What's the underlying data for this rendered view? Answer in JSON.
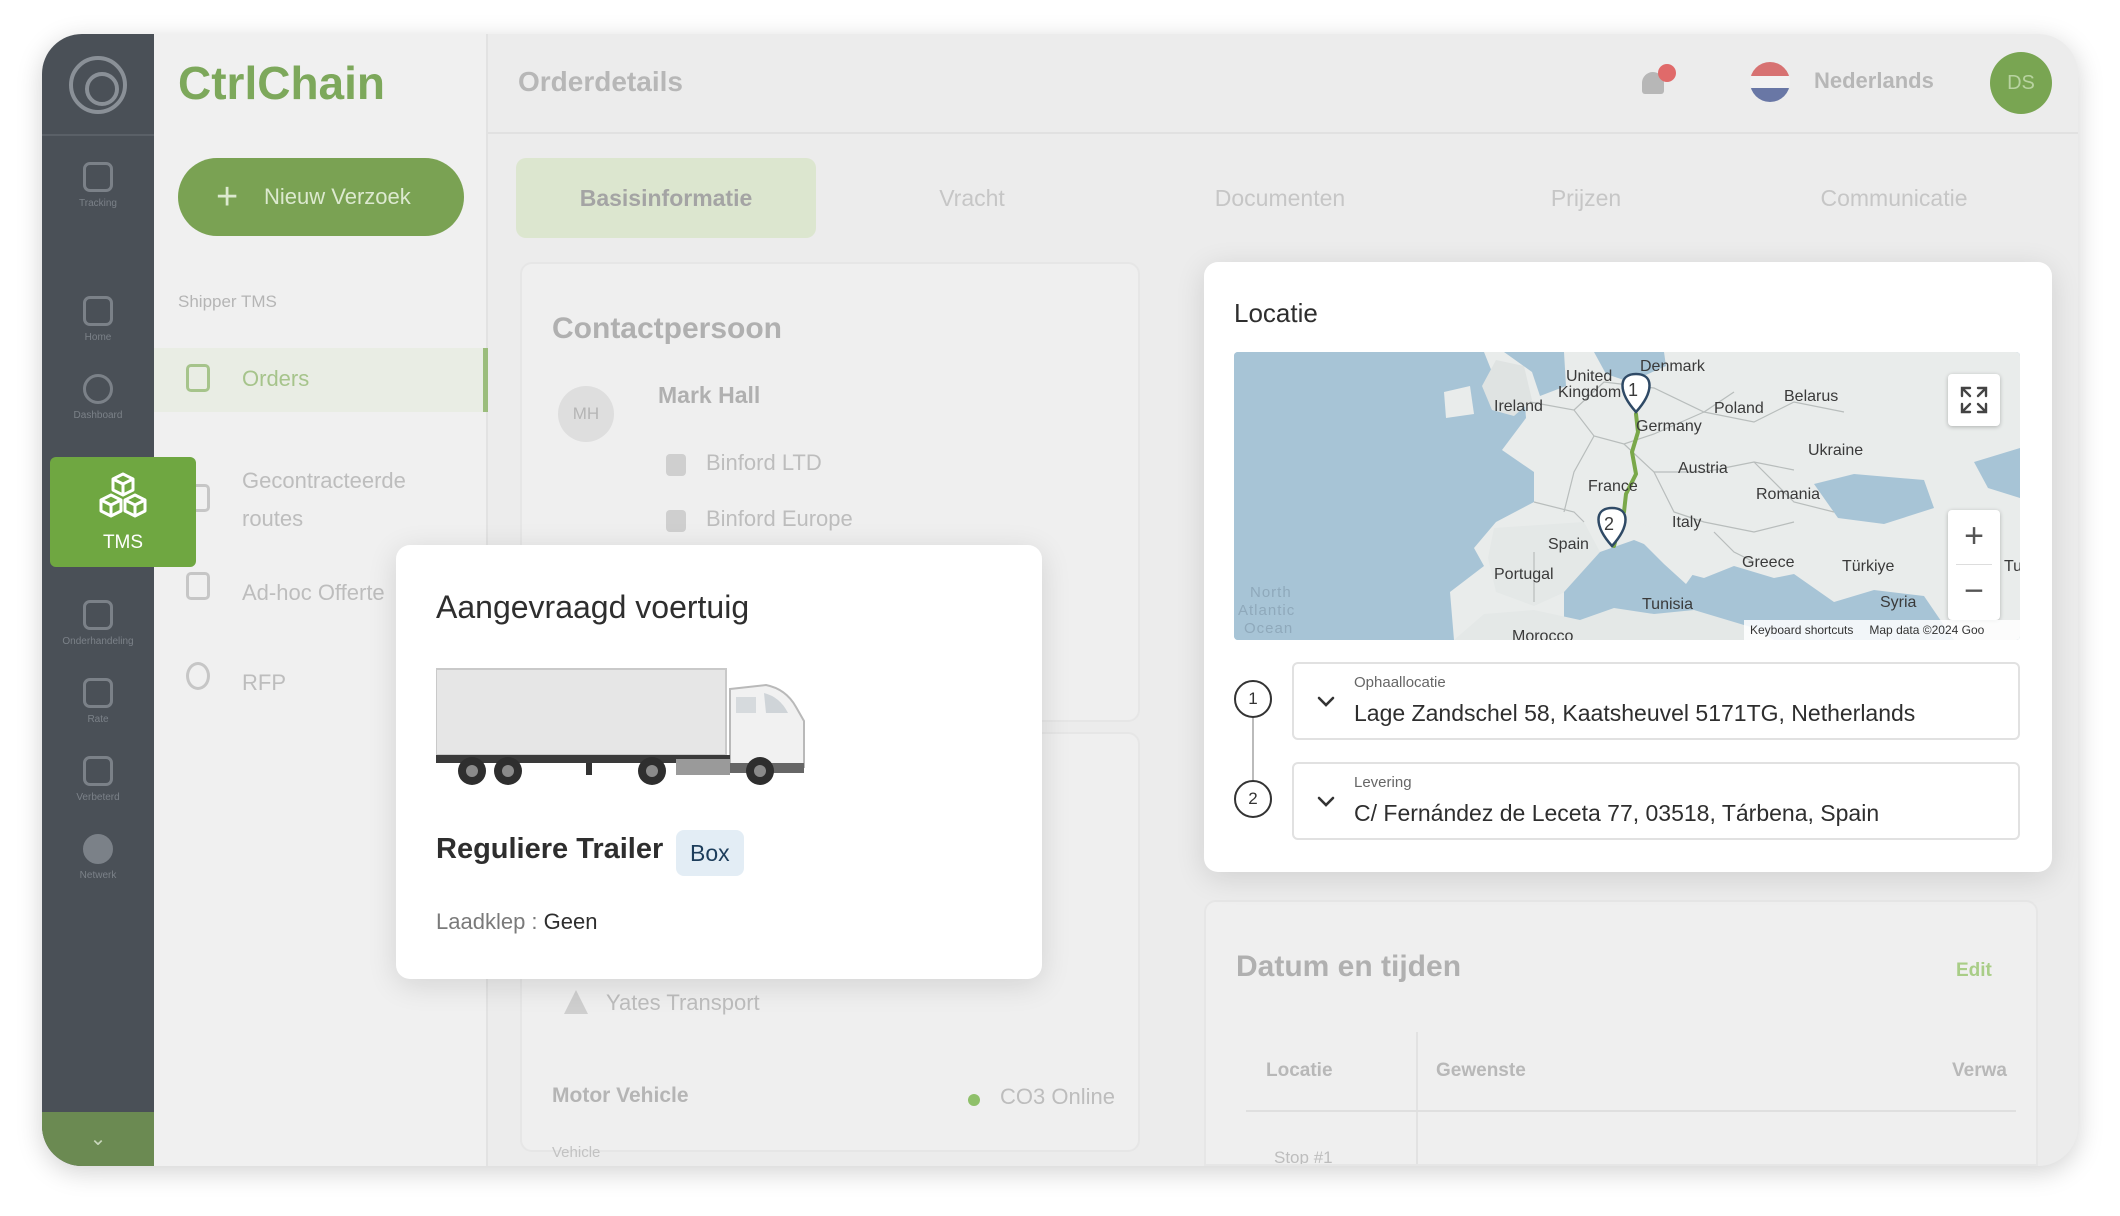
{
  "sidebar": {
    "tms_label": "TMS",
    "items": [
      "Tracking",
      "Home",
      "Dashboard",
      "Onderhandeling",
      "Rate",
      "Verbeterd",
      "Netwerk"
    ]
  },
  "brand": "CtrlChain",
  "left_nav": {
    "new_button": "Nieuw Verzoek",
    "heading": "Shipper TMS",
    "items": [
      "Orders",
      "Gecontracteerde routes",
      "Ad-hoc Offerte",
      "RFP"
    ]
  },
  "header": {
    "title": "Orderdetails",
    "language": "Nederlands",
    "avatar_initials": "DS"
  },
  "tabs": [
    "Basisinformatie",
    "Vracht",
    "Documenten",
    "Prijzen",
    "Communicatie"
  ],
  "contact": {
    "title": "Contactpersoon",
    "initials": "MH",
    "name": "Mark Hall",
    "company": "Binford LTD",
    "division": "Binford Europe"
  },
  "vehicle_bg": {
    "carrier": "Yates Transport",
    "motor_label": "Motor Vehicle",
    "co3_status": "CO3 Online",
    "vehicle_label": "Vehicle"
  },
  "dates": {
    "title": "Datum en tijden",
    "edit": "Edit",
    "columns": [
      "Locatie",
      "Gewenste",
      "Verwa"
    ],
    "stop": "Stop #1"
  },
  "vehicle_card": {
    "title": "Aangevraagd voertuig",
    "trailer_name": "Reguliere Trailer",
    "badge": "Box",
    "ladeklep_label": "Laadklep",
    "ladeklep_value": "Geen"
  },
  "location": {
    "title": "Locatie",
    "map": {
      "labels": {
        "united_kingdom_1": "United",
        "united_kingdom_2": "Kingdom",
        "ireland": "Ireland",
        "denmark": "Denmark",
        "germany": "Germany",
        "poland": "Poland",
        "belarus": "Belarus",
        "ukraine": "Ukraine",
        "france": "France",
        "austria": "Austria",
        "romania": "Romania",
        "italy": "Italy",
        "spain": "Spain",
        "portugal": "Portugal",
        "greece": "Greece",
        "turkiye": "Türkiye",
        "tu": "Tu",
        "syria": "Syria",
        "tunisia": "Tunisia",
        "morocco": "Morocco",
        "north_atlantic_1": "North",
        "north_atlantic_2": "Atlantic",
        "north_atlantic_3": "Ocean"
      },
      "markers": [
        "1",
        "2"
      ],
      "zoom_in": "+",
      "zoom_out": "−",
      "shortcuts": "Keyboard shortcuts",
      "attribution": "Map data ©2024 Goo"
    },
    "stops": [
      {
        "number": "1",
        "label": "Ophaallocatie",
        "address": "Lage Zandschel 58, Kaatsheuvel 5171TG, Netherlands"
      },
      {
        "number": "2",
        "label": "Levering",
        "address": "C/ Fernández de Leceta 77, 03518, Tárbena, Spain"
      }
    ]
  },
  "colors": {
    "accent_green": "#6fa741",
    "sidebar": "#4a5057",
    "route": "#7aa84a",
    "badge_bg": "#e3edf5"
  }
}
